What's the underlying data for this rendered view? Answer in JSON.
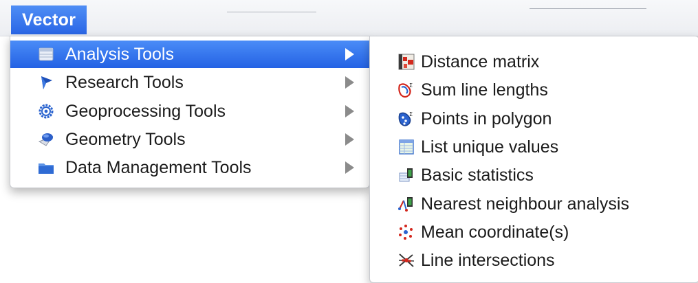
{
  "menubar": {
    "title": "Vector"
  },
  "menu": {
    "items": [
      {
        "label": "Analysis Tools",
        "icon": "table-icon",
        "active": true
      },
      {
        "label": "Research Tools",
        "icon": "research-icon"
      },
      {
        "label": "Geoprocessing Tools",
        "icon": "gear-icon"
      },
      {
        "label": "Geometry Tools",
        "icon": "geometry-icon"
      },
      {
        "label": "Data Management Tools",
        "icon": "folder-icon"
      }
    ]
  },
  "submenu": {
    "items": [
      {
        "label": "Distance matrix",
        "icon": "distance-matrix-icon"
      },
      {
        "label": "Sum line lengths",
        "icon": "sum-line-lengths-icon"
      },
      {
        "label": "Points in polygon",
        "icon": "points-in-polygon-icon"
      },
      {
        "label": "List unique values",
        "icon": "list-unique-values-icon"
      },
      {
        "label": "Basic statistics",
        "icon": "basic-statistics-icon"
      },
      {
        "label": "Nearest neighbour analysis",
        "icon": "nearest-neighbour-icon"
      },
      {
        "label": "Mean coordinate(s)",
        "icon": "mean-coordinates-icon"
      },
      {
        "label": "Line intersections",
        "icon": "line-intersections-icon"
      }
    ]
  },
  "colors": {
    "highlight": "#2f6ff0",
    "menu_bg": "#ffffff",
    "text": "#1b1b1b"
  }
}
